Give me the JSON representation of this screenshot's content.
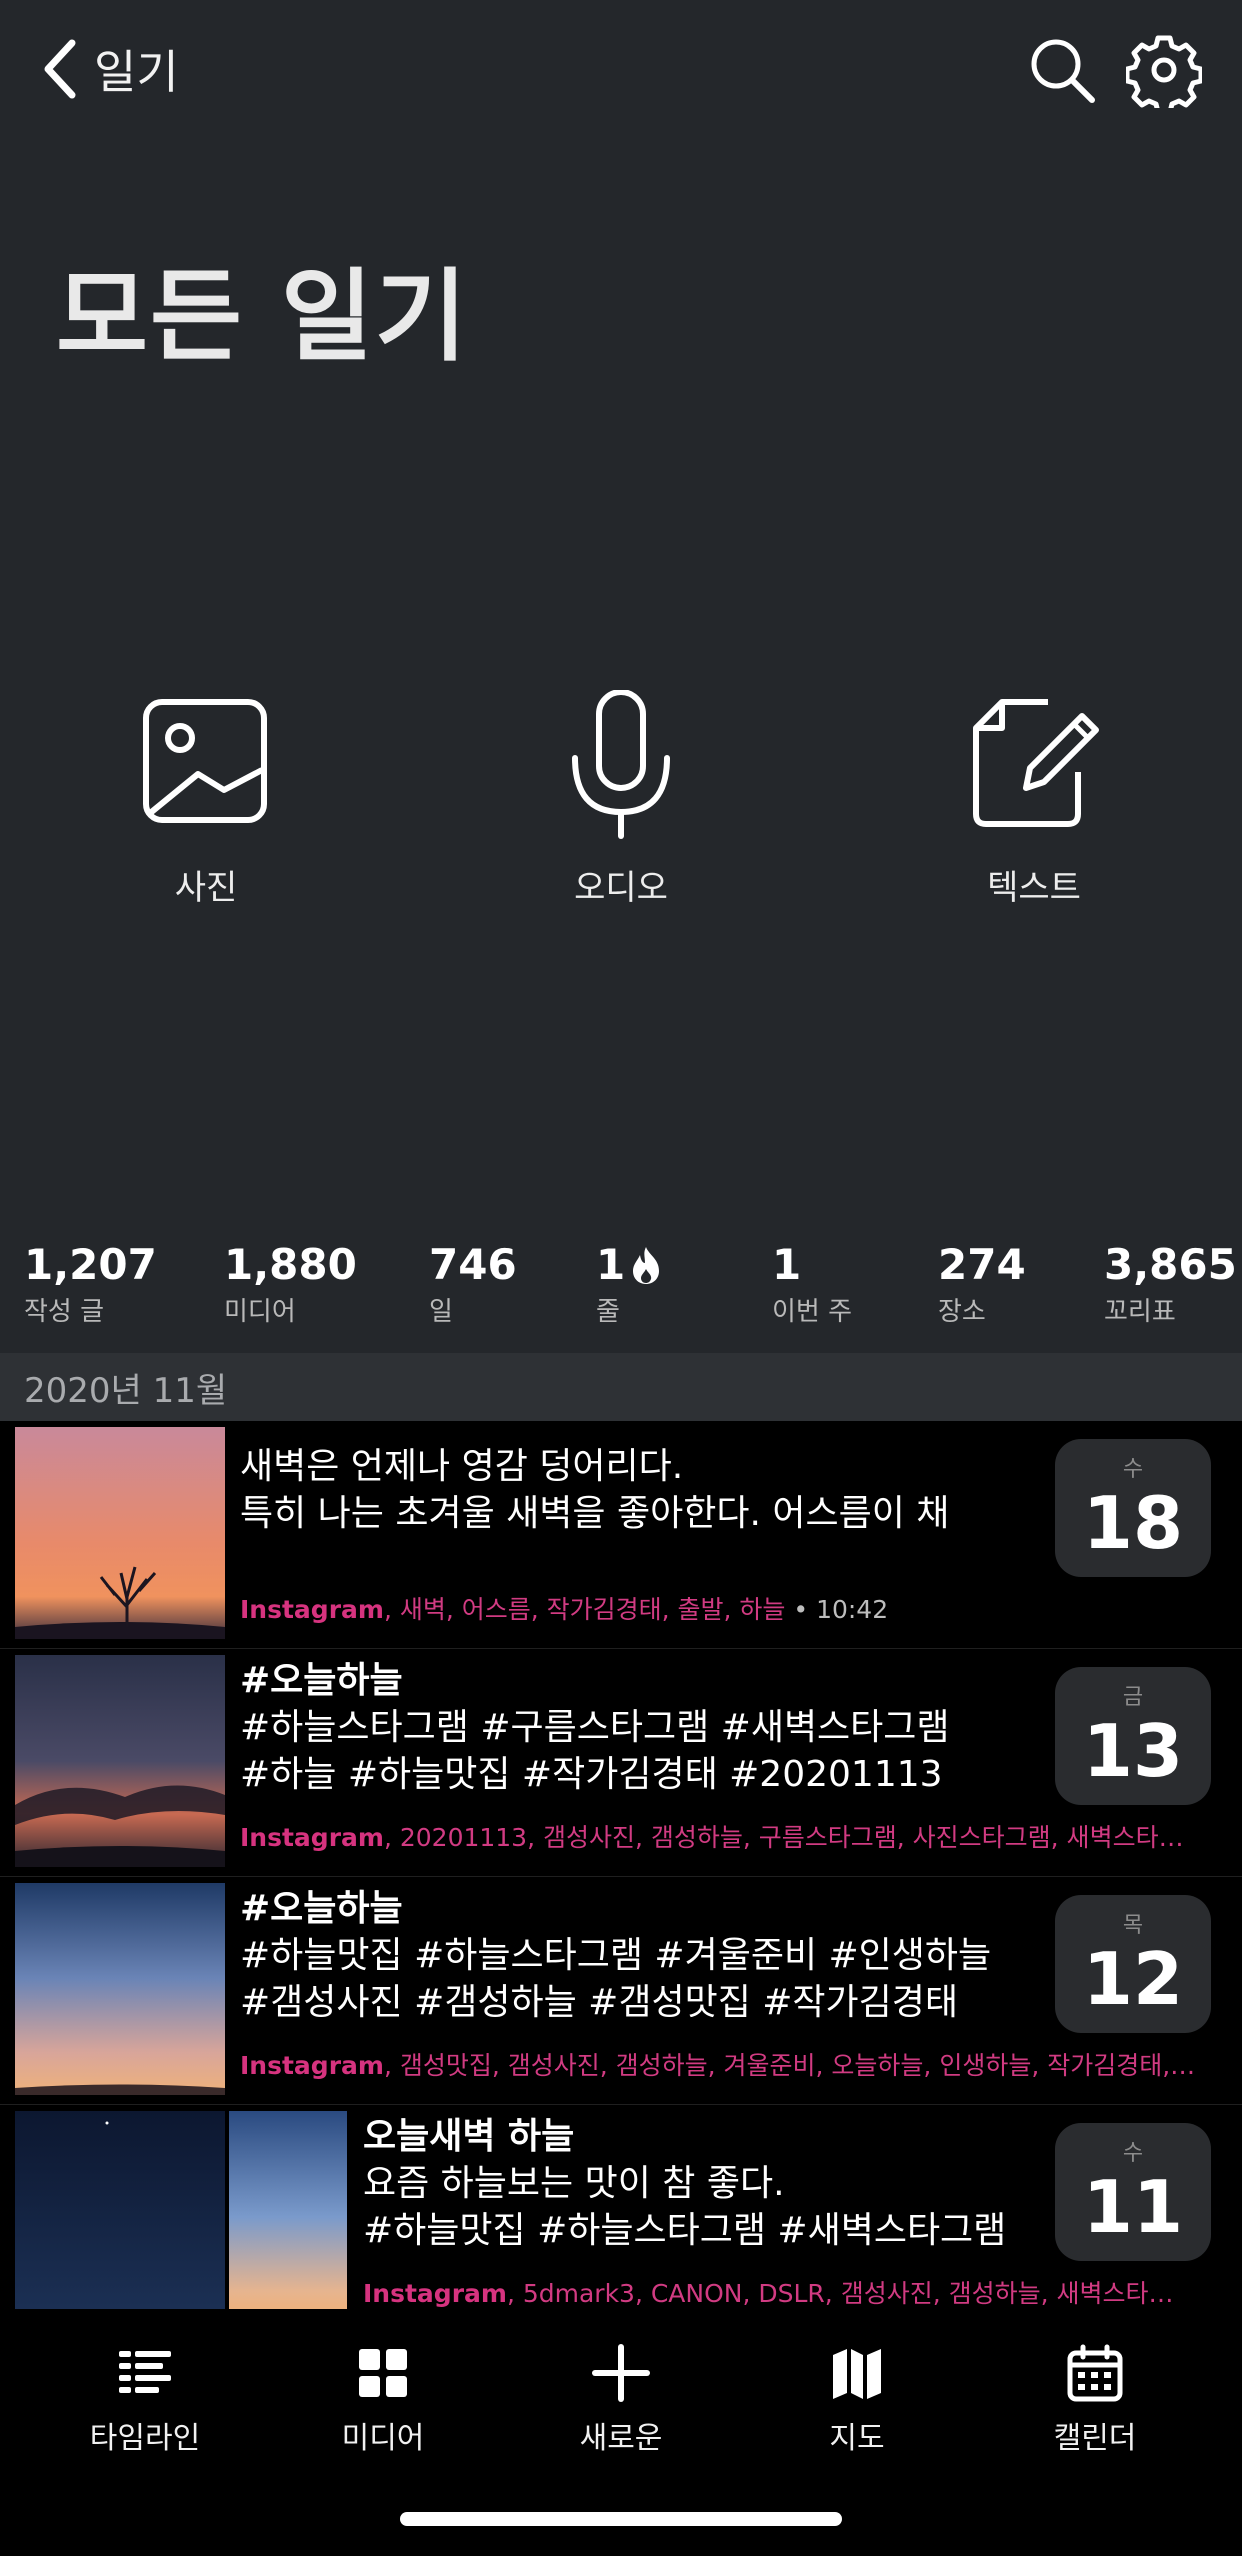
{
  "nav": {
    "back_label": "일기"
  },
  "page_title": "모든 일기",
  "actions": [
    {
      "label": "사진",
      "icon": "photo-icon"
    },
    {
      "label": "오디오",
      "icon": "microphone-icon"
    },
    {
      "label": "텍스트",
      "icon": "compose-icon"
    }
  ],
  "stats": [
    {
      "value": "1,207",
      "label": "작성 글"
    },
    {
      "value": "1,880",
      "label": "미디어"
    },
    {
      "value": "746",
      "label": "일"
    },
    {
      "value": "1",
      "label": "줄",
      "icon": "flame-icon"
    },
    {
      "value": "1",
      "label": "이번 주"
    },
    {
      "value": "274",
      "label": "장소"
    },
    {
      "value": "3,865",
      "label": "꼬리표"
    }
  ],
  "section": {
    "title": "2020년 11월"
  },
  "entries": [
    {
      "line1": "",
      "line2": "새벽은 언제나 영감 덩어리다.",
      "line3": "특히 나는 초겨울 새벽을 좋아한다. 어스름이 채",
      "source": "Instagram",
      "tags": ", 새벽, 어스름, 작가김경태, 출발, 하늘",
      "time": " • 10:42",
      "dow": "수",
      "day": "18"
    },
    {
      "line1": "#오늘하늘",
      "line2": "#하늘스타그램 #구름스타그램 #새벽스타그램",
      "line3": "#하늘 #하늘맛집 #작가김경태 #20201113",
      "source": "Instagram",
      "tags": ", 20201113, 갬성사진, 갬성하늘, 구름스타그램, 사진스타그램, 새벽스타…",
      "dow": "금",
      "day": "13"
    },
    {
      "line1": "#오늘하늘",
      "line2": "#하늘맛집 #하늘스타그램 #겨울준비 #인생하늘",
      "line3": "#갬성사진 #갬성하늘 #갬성맛집 #작가김경태",
      "source": "Instagram",
      "tags": ", 갬성맛집, 갬성사진, 갬성하늘, 겨울준비, 오늘하늘, 인생하늘, 작가김경태,…",
      "dow": "목",
      "day": "12"
    },
    {
      "line1": "오늘새벽 하늘",
      "line2": "요즘 하늘보는 맛이 참 좋다.",
      "line3": "#하늘맛집 #하늘스타그램 #새벽스타그램",
      "source": "Instagram",
      "tags": ", 5dmark3, CANON, DSLR, 갬성사진, 갬성하늘, 새벽스타…",
      "dow": "수",
      "day": "11"
    }
  ],
  "tabbar": [
    {
      "label": "타임라인",
      "icon": "timeline-icon"
    },
    {
      "label": "미디어",
      "icon": "grid-icon"
    },
    {
      "label": "새로운",
      "icon": "plus-icon"
    },
    {
      "label": "지도",
      "icon": "map-icon"
    },
    {
      "label": "캘린더",
      "icon": "calendar-icon"
    }
  ],
  "colors": {
    "background": "#24272b",
    "list_background": "#000000",
    "tag_accent": "#d13b82"
  }
}
